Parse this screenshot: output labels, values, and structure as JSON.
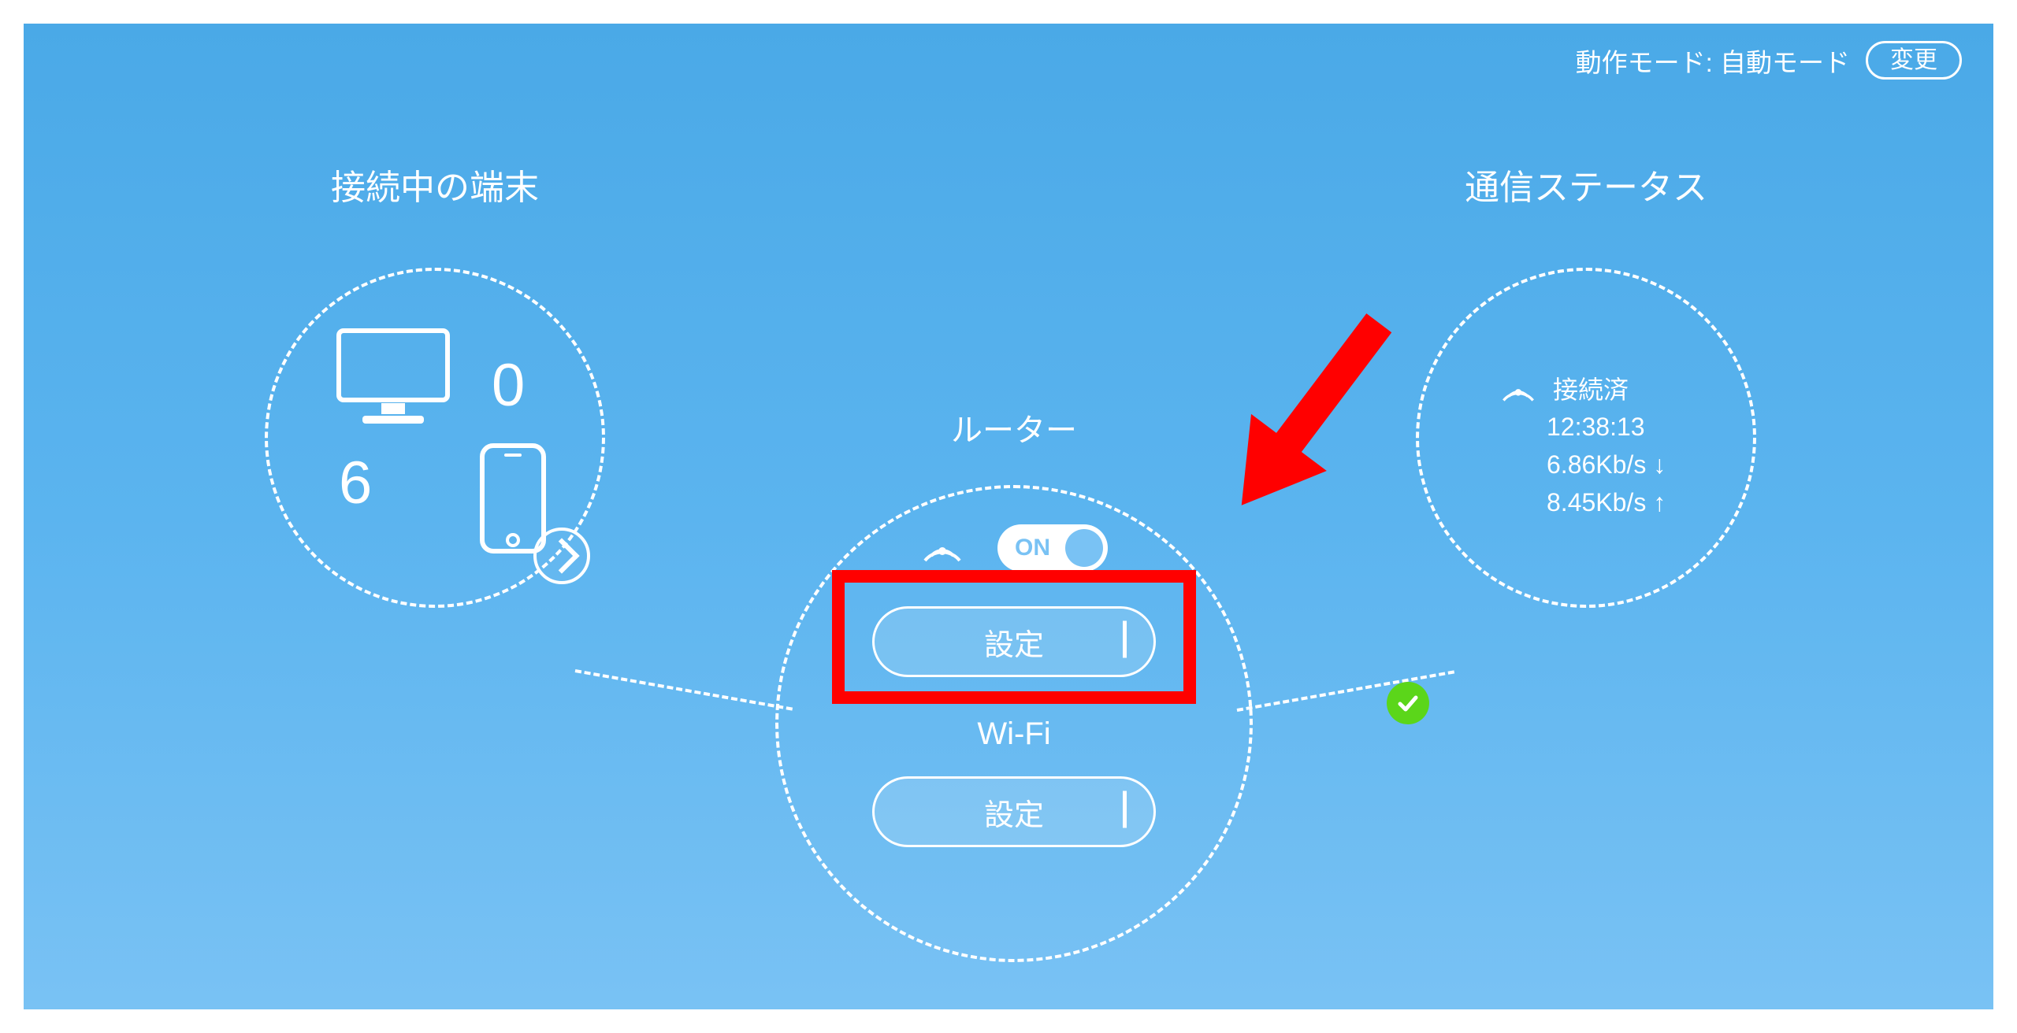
{
  "header": {
    "mode_label": "動作モード: 自動モード",
    "change_label": "変更"
  },
  "left": {
    "title": "接続中の端末",
    "desktop_count": "0",
    "mobile_count": "6"
  },
  "center": {
    "router_title": "ルーター",
    "toggle_label": "ON",
    "router_settings_label": "設定",
    "wifi_title": "Wi-Fi",
    "wifi_settings_label": "設定"
  },
  "right": {
    "title": "通信ステータス",
    "status": "接続済",
    "duration": "12:38:13",
    "down_rate": "6.86Kb/s ↓",
    "up_rate": "8.45Kb/s ↑"
  }
}
